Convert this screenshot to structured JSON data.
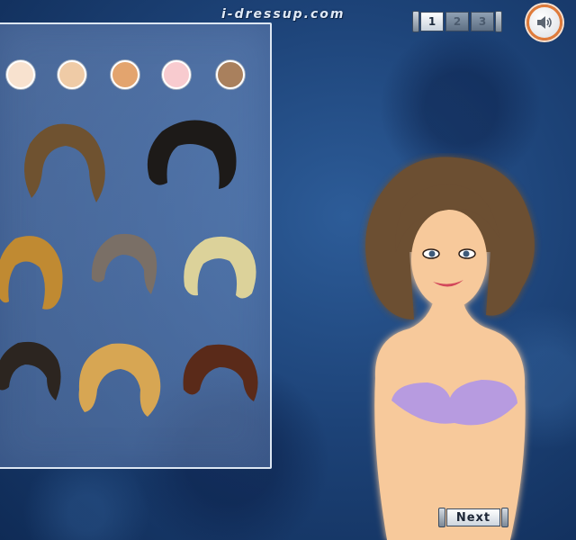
{
  "site": {
    "logo_text": "i-dressup.com"
  },
  "pager": {
    "pages": [
      "1",
      "2",
      "3"
    ],
    "current_page": 1
  },
  "sound": {
    "icon": "speaker-icon"
  },
  "skin_tones": [
    "#f8e2cf",
    "#efcba6",
    "#e3a46e",
    "#f8cbcf",
    "#a9805d"
  ],
  "hairstyles": [
    {
      "name": "curly-brown",
      "color": "#6f5230"
    },
    {
      "name": "wavy-black",
      "color": "#1d1a18"
    },
    {
      "name": "wavy-golden",
      "color": "#c08a32"
    },
    {
      "name": "short-gray",
      "color": "#7a6f66"
    },
    {
      "name": "curly-platinum",
      "color": "#dcd29a"
    },
    {
      "name": "curly-dark",
      "color": "#2c2520"
    },
    {
      "name": "voluminous-blonde",
      "color": "#d7a653"
    },
    {
      "name": "curly-auburn",
      "color": "#5a2a19"
    }
  ],
  "model": {
    "hair_color": "#6c4f31",
    "skin_color": "#f7c99b",
    "top_color": "#b79be0"
  },
  "next": {
    "label": "Next"
  }
}
